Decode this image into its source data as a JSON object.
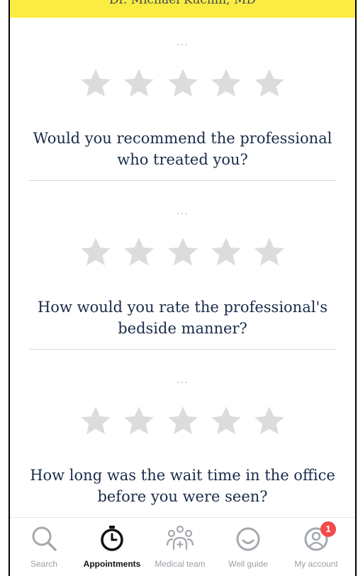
{
  "banner": {
    "text": "Dr. Michael Kuchin, MD"
  },
  "ratings": [
    {
      "dots": "...",
      "stars": 5,
      "filled": 0,
      "question": "Would you recommend the professional who treated you?"
    },
    {
      "dots": "...",
      "stars": 5,
      "filled": 0,
      "question": "How would you rate the professional's bedside manner?"
    },
    {
      "dots": "...",
      "stars": 5,
      "filled": 0,
      "question": "How long was the wait time in the office before you were seen?"
    }
  ],
  "colors": {
    "banner": "#fbec41",
    "star_empty": "#dcdcdc",
    "question_text": "#1a2b4a",
    "badge": "#f24b4b"
  },
  "nav": {
    "items": [
      {
        "label": "Search",
        "icon": "search-icon",
        "active": false
      },
      {
        "label": "Appointments",
        "icon": "stopwatch-icon",
        "active": true
      },
      {
        "label": "Medical team",
        "icon": "medical-team-icon",
        "active": false
      },
      {
        "label": "Well guide",
        "icon": "smile-icon",
        "active": false
      },
      {
        "label": "My account",
        "icon": "user-icon",
        "active": false,
        "badge": "1"
      }
    ]
  }
}
